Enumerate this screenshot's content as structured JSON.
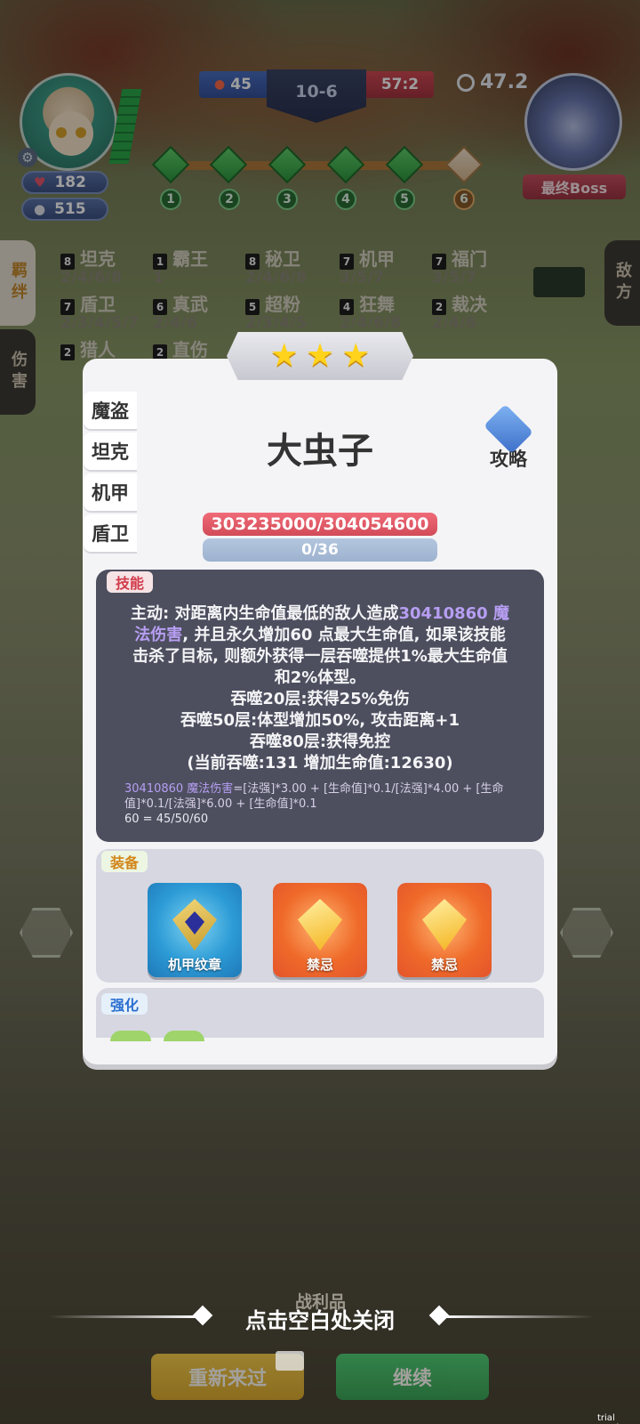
{
  "hud": {
    "hearts": "182",
    "coins": "515",
    "score_left": "45",
    "round": "10-6",
    "score_right": "57:2",
    "timer": "47.2",
    "boss_label": "最终Boss",
    "waves": [
      "1",
      "2",
      "3",
      "4",
      "5",
      "6"
    ]
  },
  "side_tabs": {
    "bond": "羁绊",
    "damage": "伤害",
    "enemy": "敌方"
  },
  "synergies": [
    {
      "count": "8",
      "name": "坦克",
      "tiers": "2/4/6/8"
    },
    {
      "count": "1",
      "name": "霸王",
      "tiers": "1"
    },
    {
      "count": "8",
      "name": "秘卫",
      "tiers": "2/4/6/8"
    },
    {
      "count": "7",
      "name": "机甲",
      "tiers": "3/5/7"
    },
    {
      "count": "7",
      "name": "福门",
      "tiers": "3/5/7"
    },
    {
      "count": "7",
      "name": "盾卫",
      "tiers": "2/3/4/5/7"
    },
    {
      "count": "6",
      "name": "真武",
      "tiers": "2/4/6"
    },
    {
      "count": "5",
      "name": "超粉",
      "tiers": "2/3/4/5"
    },
    {
      "count": "4",
      "name": "狂舞",
      "tiers": "2/4/6/8"
    },
    {
      "count": "2",
      "name": "裁决",
      "tiers": "2/4/6"
    },
    {
      "count": "2",
      "name": "猎人",
      "tiers": ""
    },
    {
      "count": "2",
      "name": "直伤",
      "tiers": ""
    }
  ],
  "modal": {
    "stars": 3,
    "classes": [
      "魔盗",
      "坦克",
      "机甲",
      "盾卫"
    ],
    "unit_name": "大虫子",
    "guide_label": "攻略",
    "hp": "303235000/304054600",
    "mana": "0/36",
    "skill_tag": "技能",
    "skill_lines": {
      "l1a": "主动: 对距离内生命值最低的敌人造成",
      "l1b": "30410860 魔",
      "l2a": "法伤害",
      "l2b": ", 并且永久增加60 点最大生命值, 如果该技能",
      "l3": "击杀了目标, 则额外获得一层吞噬提供1%最大生命值",
      "l4": "和2%体型。",
      "l5": "吞噬20层:获得25%免伤",
      "l6": "吞噬50层:体型增加50%, 攻击距离+1",
      "l7": "吞噬80层:获得免控",
      "l8": "(当前吞噬:131 增加生命值:12630)"
    },
    "formula": {
      "f1a": "30410860 魔法伤害",
      "f1b": "=[法强]*3.00 + [生命值]*0.1/[法强]*4.00 + [生命值]*0.1/[法强]*6.00 + [生命值]*0.1",
      "f2": "60 = 45/50/60"
    },
    "equip_tag": "装备",
    "equipment": [
      {
        "name": "机甲纹章",
        "icon": "mech-emblem-icon"
      },
      {
        "name": "禁忌",
        "icon": "forbidden-gem-icon"
      },
      {
        "name": "禁忌",
        "icon": "forbidden-gem-icon"
      }
    ],
    "enhance_tag": "强化"
  },
  "bottom": {
    "loot_label": "战利品",
    "close_hint": "点击空白处关闭",
    "restart_label": "重新来过",
    "continue_label": "继续",
    "trial": "trial version"
  }
}
